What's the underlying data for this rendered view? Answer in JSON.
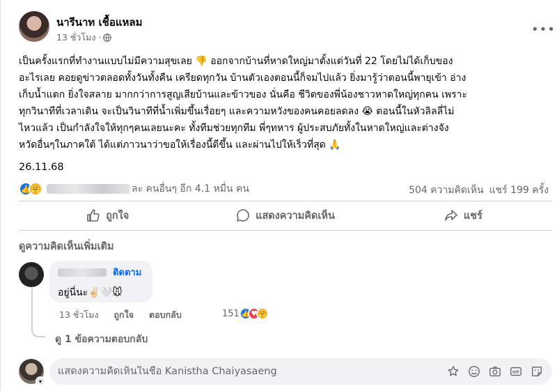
{
  "post": {
    "author": "นารีนาท เชื้อแหลม",
    "time": "13 ชั่วโมง ·",
    "lines": [
      "เป็นครั้งแรกที่ทำงานแบบไม่มีความสุขเลย 👎 ออกจากบ้านที่หาดใหญ่มาตั้งแต่วันที่ 22 โดยไม่ได้เก็บของ",
      "อะไรเลย คอยดูข่าวตลอดทั้งวันทั้งคืน เครียดทุกวัน บ้านตัวเองตอนนี้ก็จมไปแล้ว ยิ่งมารู้ว่าตอนนี้พายุเข้า อ่าง",
      "เก็บน้ำแตก ยิ่งใจสลาย มากกว่าการสูญเสียบ้านและข้าวของ นั่นคือ ชีวิตของพี่น้องชาวหาดใหญ่ทุกคน เพราะ",
      "ทุกวินาทีที่เวลาเดิน จะเป็นวินาทีที่น้ำเพิ่มขึ้นเรื่อยๆ และความหวังของคนคอยลดลง 😭 ตอนนี้ในหัวลิลลี่ไม่",
      "ไหวแล้ว เป็นกำลังใจให้ทุกๆคนเลยนะคะ ทั้งทีมช่วยทุกทีม พี่ๆทหาร ผู้ประสบภัยทั้งในหาดใหญ่และต่างจัง",
      "หวัดอื่นๆในภาคใต้ ได้แต่ภาวนาว่าขอให้เรื่องนี้ดีขึ้น และผ่านไปให้เร็วที่สุด 🙏"
    ],
    "date": "26.11.68",
    "reaction_text": "ละ คนอื่นๆ อีก 4.1 หมื่น คน",
    "comments_count": "504 ความคิดเห็น",
    "shares_count": "แชร์ 199 ครั้ง"
  },
  "actions": {
    "like": "ถูกใจ",
    "comment": "แสดงความคิดเห็น",
    "share": "แชร์"
  },
  "comments_section": {
    "see_more": "ดูความคิดเห็นเพิ่มเติม",
    "comment": {
      "follow": "ติดตาม",
      "text": "อยู่นี่นะ✌🏻🤍🐭",
      "time": "13 ชั่วโมง",
      "like": "ถูกใจ",
      "reply": "ตอบกลับ",
      "reaction_count": "151"
    },
    "view_replies": "ดู 1 ข้อความตอบกลับ"
  },
  "composer": {
    "placeholder": "แสดงความคิดเห็นในชื่อ Kanistha Chaiyasaeng"
  },
  "icons": [
    "globe-icon",
    "more-icon",
    "like-icon",
    "comment-icon",
    "share-icon",
    "sticker-icon",
    "emoji-icon",
    "camera-icon",
    "gif-icon",
    "sticker-2-icon"
  ],
  "colors": {
    "accent": "#0866ff",
    "like": "#1b74e4",
    "love": "#f33e58",
    "care": "#f7b125",
    "muted": "#65676b"
  }
}
